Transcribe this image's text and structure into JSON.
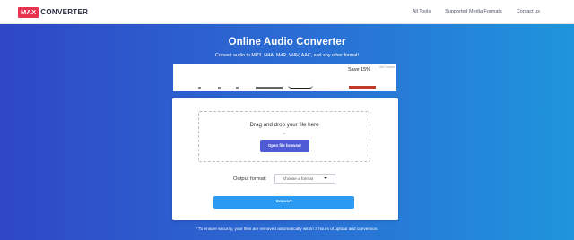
{
  "navbar": {
    "logo_badge": "MAX",
    "logo_text": "CONVERTER",
    "links": [
      "All Tools",
      "Supported Media Formats",
      "Contact us"
    ]
  },
  "hero": {
    "title": "Online Audio Converter",
    "subtitle": "Convert audio to MP3, M4A, M4R, WAV, AAC, and any other format!"
  },
  "ad": {
    "text": "Save 15%",
    "choices_label": "AdChoices"
  },
  "upload": {
    "drop_text": "Drag and drop your file here",
    "or_text": "or",
    "browse_label": "Open file browser"
  },
  "output": {
    "label": "Output format:",
    "selected": "choose a format"
  },
  "convert_label": "Convert",
  "security_note": "* To ensure security, your files are removed automatically within 3 hours of upload and conversion.",
  "colors": {
    "logo_red": "#e8344e",
    "browse_button": "#4f5bd5",
    "convert_button": "#2b9af3",
    "gradient_start": "#2f47c6",
    "gradient_end": "#1e95dc"
  }
}
